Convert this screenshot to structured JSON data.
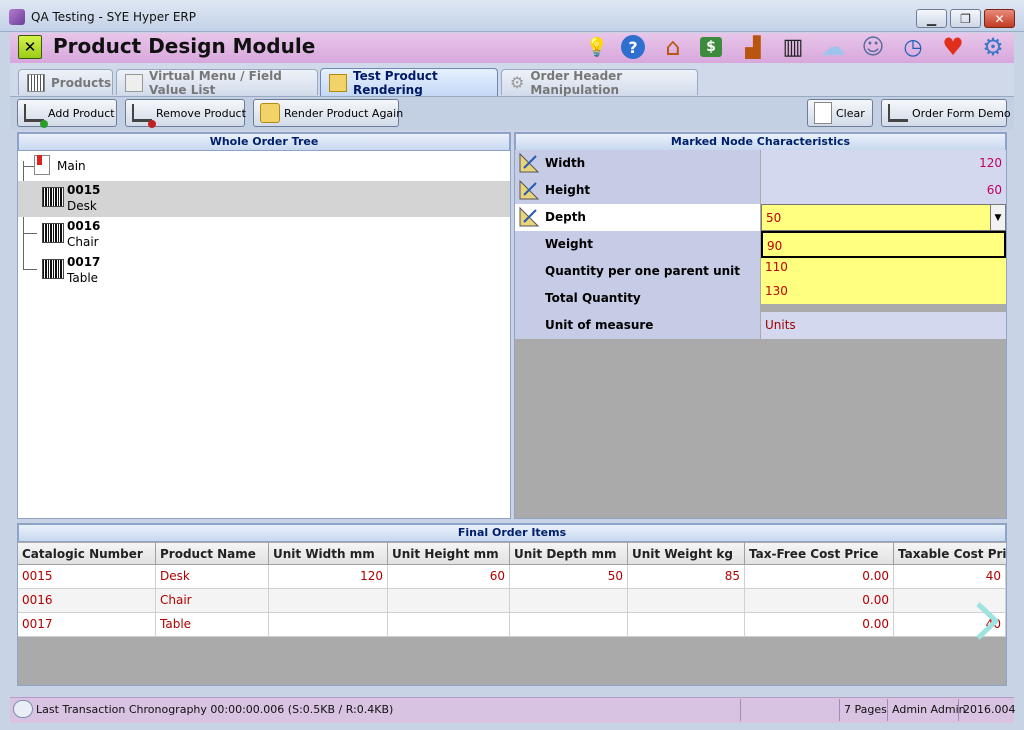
{
  "window": {
    "title": "QA Testing - SYE Hyper ERP",
    "min": "▁",
    "max": "❐",
    "close": "✕"
  },
  "module": {
    "close_glyph": "✕",
    "title": "Product Design Module"
  },
  "header_icons": [
    {
      "name": "lightbulb-icon",
      "glyph": "💡"
    },
    {
      "name": "help-icon",
      "glyph": "?"
    },
    {
      "name": "home-icon",
      "glyph": "⌂"
    },
    {
      "name": "money-icon",
      "glyph": "$"
    },
    {
      "name": "factory-icon",
      "glyph": "▟"
    },
    {
      "name": "barcode-icon",
      "glyph": "▥"
    },
    {
      "name": "cloud-icon",
      "glyph": "☁"
    },
    {
      "name": "users-icon",
      "glyph": "☺"
    },
    {
      "name": "clock-icon",
      "glyph": "◷"
    },
    {
      "name": "heart-icon",
      "glyph": "♥"
    },
    {
      "name": "settings-icon",
      "glyph": "⚙"
    }
  ],
  "tabs": [
    {
      "label": "Products"
    },
    {
      "label": "Virtual Menu / Field Value List"
    },
    {
      "label": "Test Product Rendering"
    },
    {
      "label": "Order Header Manipulation"
    }
  ],
  "toolbar": {
    "add": "Add Product",
    "remove": "Remove Product",
    "render": "Render Product Again",
    "clear": "Clear",
    "order_form": "Order Form Demo"
  },
  "tree": {
    "title": "Whole Order Tree",
    "root": "Main",
    "nodes": [
      {
        "code": "0015",
        "name": "Desk",
        "selected": true
      },
      {
        "code": "0016",
        "name": "Chair",
        "selected": false
      },
      {
        "code": "0017",
        "name": "Table",
        "selected": false
      }
    ]
  },
  "characteristics": {
    "title": "Marked Node Characteristics",
    "rows": [
      {
        "label": "Width",
        "value": "120"
      },
      {
        "label": "Height",
        "value": "60"
      },
      {
        "label": "Depth",
        "value": "50"
      },
      {
        "label": "Weight",
        "value": "90"
      },
      {
        "label": "Quantity per one parent unit",
        "value": "110"
      },
      {
        "label": "Total Quantity",
        "value": "130"
      },
      {
        "label": "Unit of measure",
        "value": "Units"
      }
    ]
  },
  "grid": {
    "title": "Final Order Items",
    "columns": [
      "Catalogic Number",
      "Product Name",
      "Unit Width mm",
      "Unit Height mm",
      "Unit Depth mm",
      "Unit Weight kg",
      "Tax-Free Cost Price",
      "Taxable Cost Pric"
    ],
    "rows": [
      [
        "0015",
        "Desk",
        "120",
        "60",
        "50",
        "85",
        "0.00",
        "40"
      ],
      [
        "0016",
        "Chair",
        "",
        "",
        "",
        "",
        "0.00",
        ""
      ],
      [
        "0017",
        "Table",
        "",
        "",
        "",
        "",
        "0.00",
        "40"
      ]
    ]
  },
  "status": {
    "chronography": "Last Transaction Chronography  00:00:00.006  (S:0.5KB / R:0.4KB)",
    "pages": "7 Pages",
    "user": "Admin Admin",
    "version": "2016.004"
  }
}
